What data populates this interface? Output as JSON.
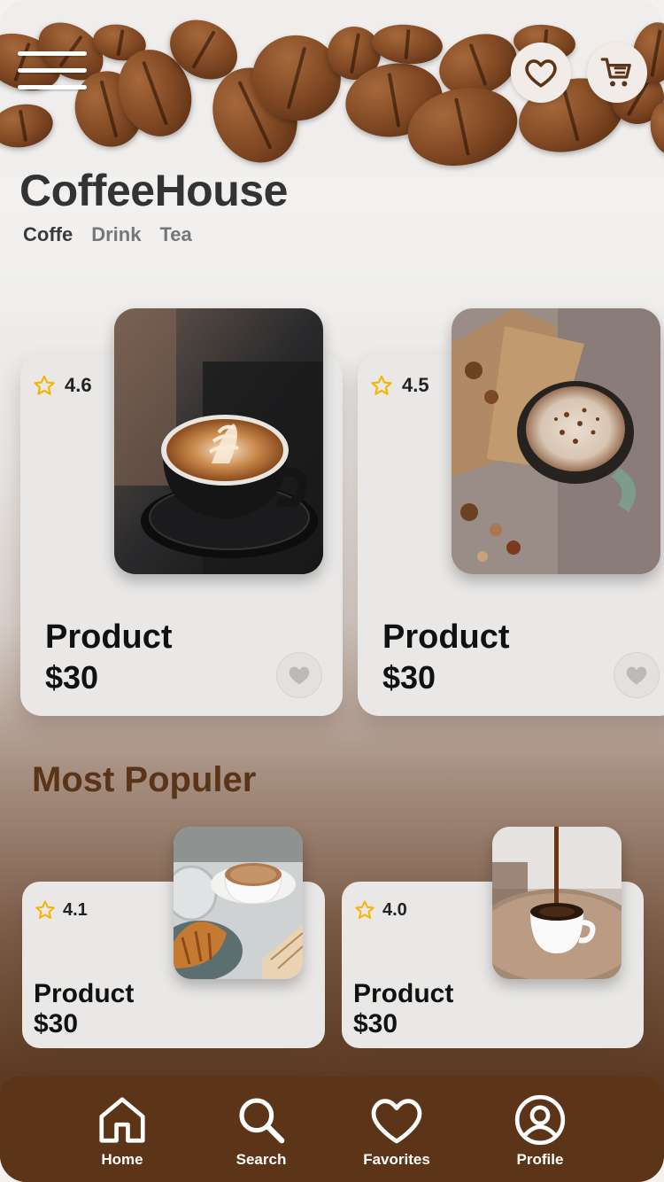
{
  "app": {
    "title": "CoffeeHouse"
  },
  "categories": [
    {
      "label": "Coffe",
      "active": true
    },
    {
      "label": "Drink",
      "active": false
    },
    {
      "label": "Tea",
      "active": false
    }
  ],
  "header": {
    "menu_icon": "hamburger-menu-icon",
    "favorites_icon": "heart-icon",
    "cart_icon": "cart-icon"
  },
  "featured": [
    {
      "rating": "4.6",
      "name": "Product",
      "price": "$30",
      "image": "latte-art-cup"
    },
    {
      "rating": "4.5",
      "name": "Product",
      "price": "$30",
      "image": "cappuccino-with-bread"
    }
  ],
  "popular": {
    "title": "Most Populer",
    "items": [
      {
        "rating": "4.1",
        "name": "Product",
        "price": "$30",
        "image": "cappuccino-with-croissant"
      },
      {
        "rating": "4.0",
        "name": "Product",
        "price": "$30",
        "image": "espresso-pour"
      }
    ]
  },
  "nav": [
    {
      "label": "Home",
      "icon": "home-icon"
    },
    {
      "label": "Search",
      "icon": "search-icon"
    },
    {
      "label": "Favorites",
      "icon": "heart-icon"
    },
    {
      "label": "Profile",
      "icon": "profile-icon"
    }
  ],
  "colors": {
    "accent": "#5c3519",
    "star": "#f4b400",
    "section_title": "#5a3418"
  }
}
